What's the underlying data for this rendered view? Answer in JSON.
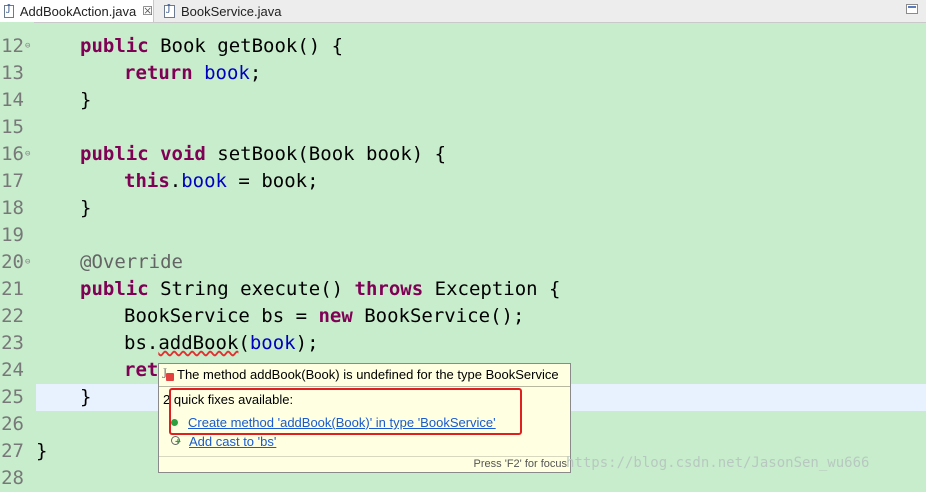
{
  "tabs": [
    {
      "label": "AddBookAction.java",
      "close": "☒"
    },
    {
      "label": "BookService.java"
    }
  ],
  "lines": [
    {
      "num": "12",
      "fold": "⊖"
    },
    {
      "num": "13"
    },
    {
      "num": "14"
    },
    {
      "num": "15"
    },
    {
      "num": "16",
      "fold": "⊖"
    },
    {
      "num": "17"
    },
    {
      "num": "18"
    },
    {
      "num": "19"
    },
    {
      "num": "20",
      "fold": "⊖"
    },
    {
      "num": "21"
    },
    {
      "num": "22"
    },
    {
      "num": "23"
    },
    {
      "num": "24"
    },
    {
      "num": "25"
    },
    {
      "num": "26"
    },
    {
      "num": "27"
    },
    {
      "num": "28"
    }
  ],
  "code": {
    "l12": {
      "kw1": "public",
      "t1": " Book getBook() {"
    },
    "l13": {
      "kw1": "return",
      "fld": "book",
      "t1": ";"
    },
    "l14": {
      "t1": "}"
    },
    "l16": {
      "kw1": "public",
      "kw2": "void",
      "t1": " setBook(Book ",
      "param": "book",
      "t2": ") {"
    },
    "l17": {
      "kw1": "this",
      "t1": ".",
      "fld": "book",
      "t2": " = ",
      "param": "book",
      "t3": ";"
    },
    "l18": {
      "t1": "}"
    },
    "l20": {
      "ann": "@Override"
    },
    "l21": {
      "kw1": "public",
      "t1": " String execute() ",
      "kw2": "throws",
      "t2": " Exception {"
    },
    "l22": {
      "t1": "BookService bs = ",
      "kw1": "new",
      "t2": " BookService();"
    },
    "l23": {
      "t1": "bs.",
      "err": "addBook",
      "t2": "(",
      "fld": "book",
      "t3": ");"
    },
    "l24": {
      "kw1": "ret"
    },
    "l25": {
      "t1": "}"
    },
    "l27": {
      "t1": "}"
    }
  },
  "popup": {
    "message": "The method addBook(Book) is undefined for the type BookService",
    "count": "2 quick fixes available:",
    "fixes": [
      "Create method 'addBook(Book)' in type 'BookService'",
      "Add cast to 'bs'"
    ],
    "status": "Press 'F2' for focus"
  },
  "watermark": "https://blog.csdn.net/JasonSen_wu666"
}
